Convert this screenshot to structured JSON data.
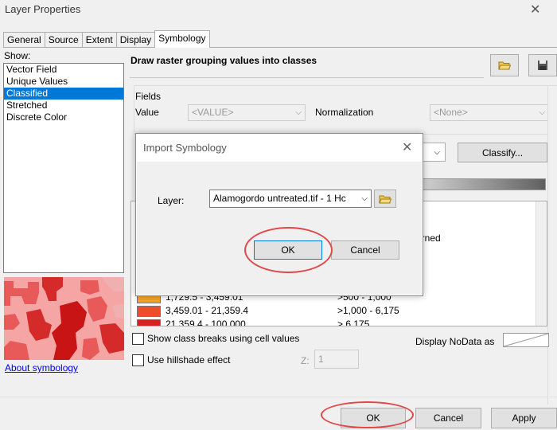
{
  "window": {
    "title": "Layer Properties"
  },
  "tabs": [
    "General",
    "Source",
    "Extent",
    "Display",
    "Symbology"
  ],
  "show_label": "Show:",
  "renderers": [
    "Vector Field",
    "Unique Values",
    "Classified",
    "Stretched",
    "Discrete Color"
  ],
  "selected_renderer": "Classified",
  "about_link": "About symbology",
  "main": {
    "heading": "Draw raster grouping values into classes",
    "fields_label": "Fields",
    "value_label": "Value",
    "value_combo": "<VALUE>",
    "normalization_label": "Normalization",
    "normalization_combo": "<None>",
    "classify_button": "Classify...",
    "partial_text": "urned",
    "legend": [
      {
        "range": "1,729.5 - 3,459.01",
        "label": ">500 - 1,000",
        "color": "#f5a623"
      },
      {
        "range": "3,459.01 - 21,359.4",
        "label": ">1,000 - 6,175",
        "color": "#f04d2d"
      },
      {
        "range": "21,359.4 - 100,000",
        "label": "> 6,175",
        "color": "#d62020"
      }
    ],
    "show_breaks_label": "Show class breaks using cell values",
    "hillshade_label": "Use hillshade effect",
    "z_label": "Z:",
    "z_value": "1",
    "nodata_label": "Display NoData as"
  },
  "dialog": {
    "title": "Import Symbology",
    "layer_label": "Layer:",
    "layer_value": "Alamogordo untreated.tif - 1 Hc",
    "ok": "OK",
    "cancel": "Cancel"
  },
  "footer": {
    "ok": "OK",
    "cancel": "Cancel",
    "apply": "Apply"
  },
  "colors": {
    "highlight_oval": "#e0484a",
    "selection": "#0078d7"
  }
}
